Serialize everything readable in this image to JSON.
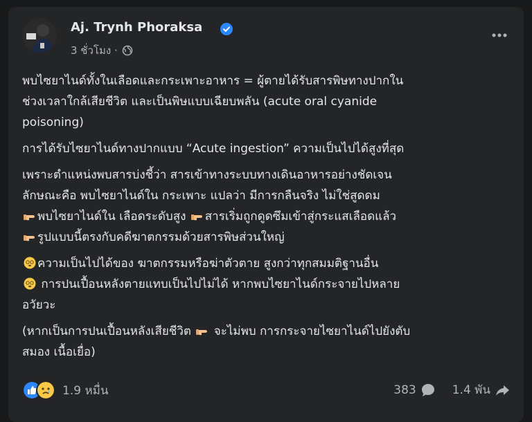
{
  "post": {
    "author": "Aj. Trynh Phoraksa",
    "time": "3 ชั่วโมง ·",
    "paragraphs": [
      [
        "พบไซยาไนด์ทั้งในเลือดและกระเพาะอาหาร = ผู้ตายได้รับสารพิษทางปากใน",
        "ช่วงเวลาใกล้เสียชีวิต และเป็นพิษแบบเฉียบพลัน (acute oral cyanide",
        "poisoning)"
      ],
      [
        " การได้รับไซยาไนด์ทางปากแบบ “Acute ingestion” ความเป็นไปได้สูงที่สุด"
      ],
      [
        "เพราะตำแหน่งพบสารบ่งชี้ว่า สารเข้าทางระบบทางเดินอาหารอย่างชัดเจน",
        "ลักษณะคือ พบไซยาไนด์ใน กระเพาะ แปลว่า มีการกลืนจริง ไม่ใช่สูดดม"
      ]
    ],
    "emoji_lines": {
      "l1a": "พบไซยาไนด์ใน เลือดระดับสูง",
      "l1b": "สารเริ่มถูกดูดซึมเข้าสู่กระแสเลือดแล้ว",
      "l2": "รูปแบบนี้ตรงกับคดีฆาตกรรมด้วยสารพิษส่วนใหญ่",
      "l3": "ความเป็นไปได้ของ ฆาตกรรมหรือฆ่าตัวตาย สูงกว่าทุกสมมติฐานอื่น",
      "l4": " การปนเปื้อนหลังตายแทบเป็นไปไม่ได้ หากพบไซยาไนด์กระจายไปหลาย",
      "l4b": "อวัยวะ",
      "l5a": "(หากเป็นการปนเปื้อนหลังเสียชีวิต",
      "l5b": " จะไม่พบ การกระจายไซยาไนด์ไปยังตับ",
      "l5c": "สมอง เนื้อเยื่อ)"
    },
    "reactions_count": "1.9 หมื่น",
    "comments_count": "383",
    "shares_count": "1.4 พัน"
  },
  "icons": {
    "verified": "verified-badge-icon",
    "globe": "globe-icon",
    "more": "more-options-icon",
    "point_right": "backhand-index-pointing-right-icon",
    "dizzy_face": "face-with-spiral-eyes-icon",
    "like": "like-reaction-icon",
    "sad": "sad-reaction-icon",
    "comment": "comment-icon",
    "share": "share-icon"
  },
  "colors": {
    "background": "#18191a",
    "card": "#242526",
    "text": "#e4e6eb",
    "muted": "#b0b3b8",
    "accent": "#2d88ff"
  }
}
